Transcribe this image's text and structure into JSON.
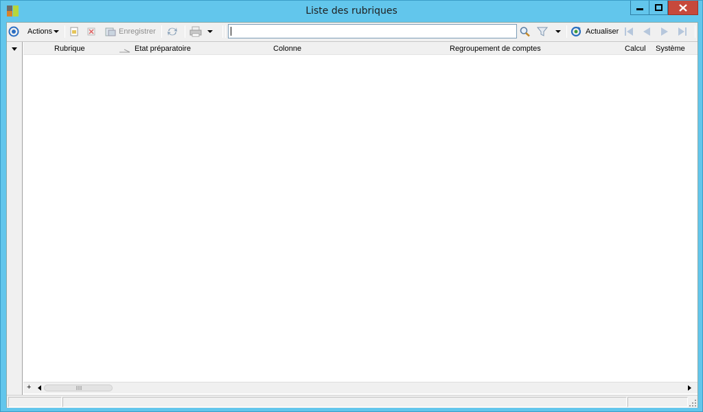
{
  "window": {
    "title": "Liste des rubriques",
    "icons": [
      "app-icon",
      "minimize-icon",
      "maximize-icon",
      "close-icon"
    ],
    "colors": {
      "frame": "#62c6ec",
      "close": "#c7493b"
    }
  },
  "toolbar": {
    "actions_label": "Actions",
    "save_label": "Enregistrer",
    "refresh_label": "Actualiser",
    "search_value": "",
    "icons": [
      "home-circle-icon",
      "new-document-icon",
      "delete-icon",
      "save-icon",
      "sync-icon",
      "print-icon",
      "search-icon",
      "filter-icon",
      "refresh-icon",
      "first-page-icon",
      "previous-page-icon",
      "next-page-icon",
      "last-page-icon"
    ]
  },
  "grid": {
    "columns": [
      "Rubrique",
      "Etat préparatoire",
      "Colonne",
      "Regroupement de comptes",
      "Calcul",
      "Système"
    ],
    "rows": []
  },
  "scrollbar": {
    "add_label": "+"
  }
}
